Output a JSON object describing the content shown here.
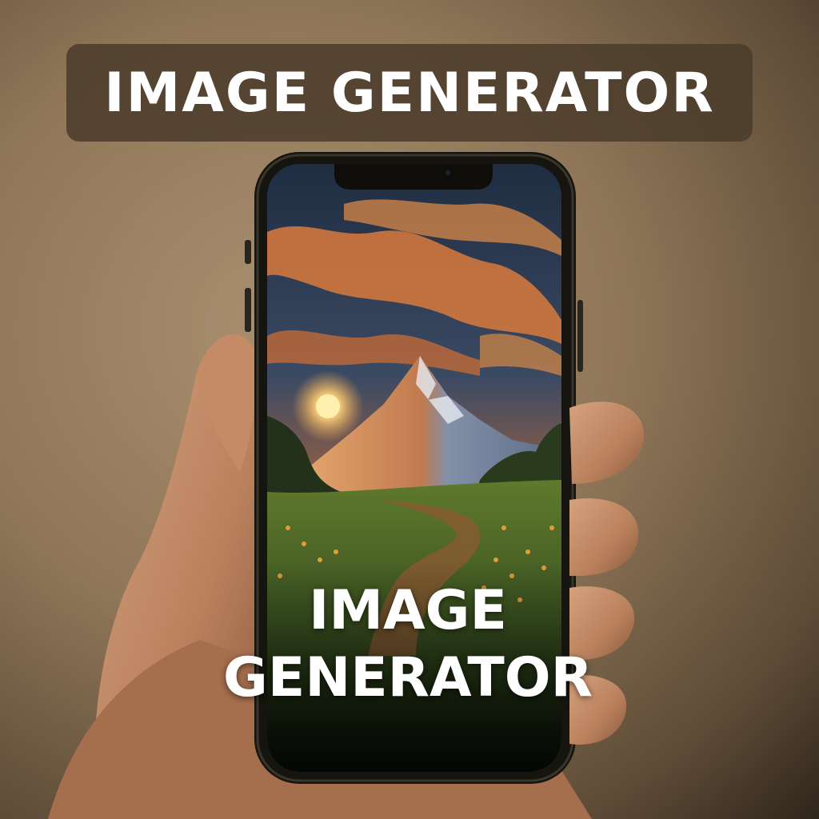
{
  "banner": {
    "title": "IMAGE GENERATOR"
  },
  "screen": {
    "line1": "IMAGE",
    "line2": "GENERATOR"
  },
  "colors": {
    "banner_bg": "#4b3c2b",
    "text": "#ffffff",
    "sky_top": "#27384f",
    "sunset": "#e58a3c",
    "meadow": "#3e5a22"
  }
}
